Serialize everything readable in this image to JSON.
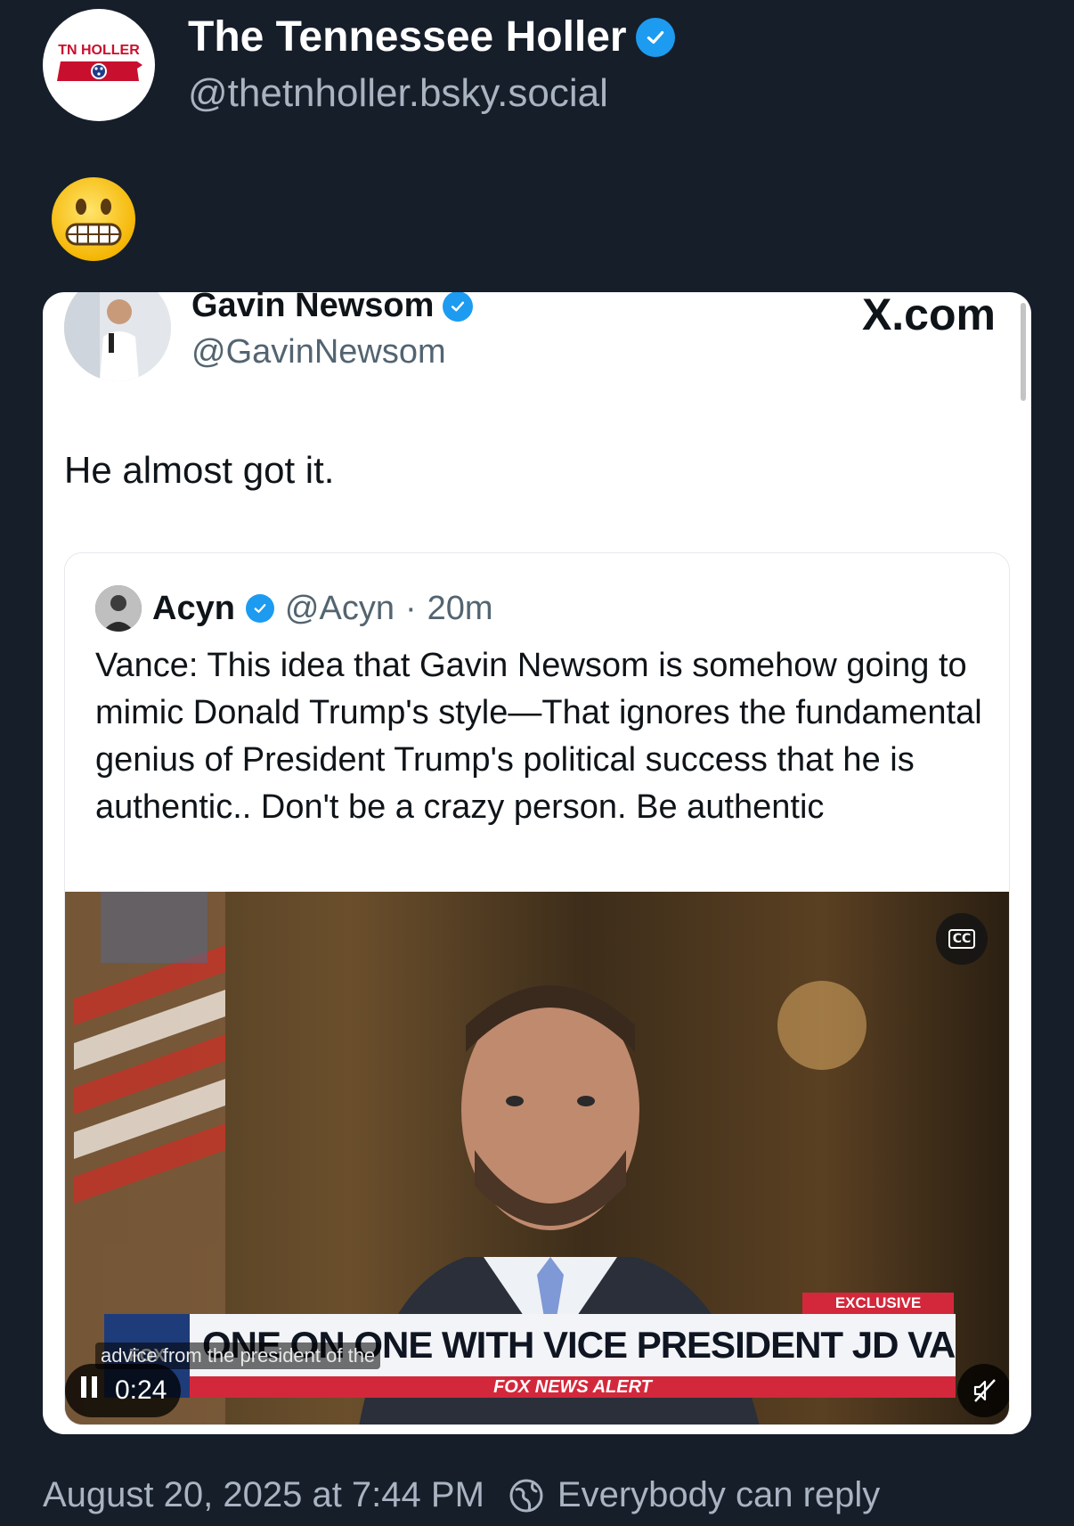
{
  "post": {
    "author_name": "The Tennessee Holler",
    "author_handle": "@thetnholler.bsky.social",
    "avatar_logo_text": "TN HOLLER",
    "body_emoji": "grimacing-face",
    "timestamp": "August 20, 2025 at 7:44 PM",
    "reply_setting": "Everybody can reply"
  },
  "quoted": {
    "author_name": "Gavin Newsom",
    "author_handle": "@GavinNewsom",
    "source": "X.com",
    "text": "He almost got it.",
    "inner": {
      "author_name": "Acyn",
      "author_handle": "@Acyn",
      "separator": "·",
      "time": "20m",
      "body": "Vance: This idea that Gavin Newsom is somehow going to mimic Donald Trump's style—That ignores the fundamental genius of President Trump's political success that he is authentic.. Don't be a crazy person. Be authentic"
    },
    "video": {
      "chyron_tag": "EXCLUSIVE",
      "chyron_main": "ONE ON ONE WITH VICE PRESIDENT JD VANCE",
      "chyron_bottom": "FOX NEWS ALERT",
      "caption": "advice from the president of the",
      "time": "0:24",
      "cc_label": "CC"
    }
  },
  "colors": {
    "background": "#161e2a",
    "verified": "#1d9bf0",
    "secondary_text": "#a9b3c1",
    "fox_red": "#d3283b"
  }
}
